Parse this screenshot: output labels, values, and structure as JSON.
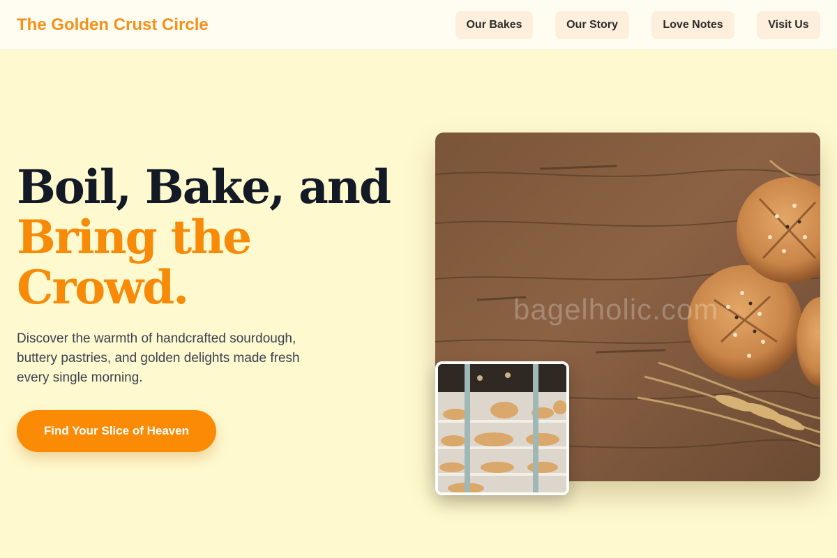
{
  "brand": {
    "name": "The Golden Crust Circle"
  },
  "nav": {
    "items": [
      {
        "label": "Our Bakes"
      },
      {
        "label": "Our Story"
      },
      {
        "label": "Love Notes"
      },
      {
        "label": "Visit Us"
      }
    ]
  },
  "hero": {
    "title_line1": "Boil, Bake, and",
    "title_line2": "Bring the",
    "title_line3": "Crowd.",
    "description": "Discover the warmth of handcrafted sourdough, buttery pastries, and golden delights made fresh every single morning.",
    "cta_label": "Find Your Slice of Heaven"
  },
  "images": {
    "main_watermark": "bagelholic.com",
    "main_alt": "Seeded bread rolls with wheat stalks on a rustic wooden table",
    "inset_alt": "Bakery display case filled with pastries and breads"
  },
  "colors": {
    "background": "#fef9cf",
    "brand": "#f59019",
    "accent": "#f78a07",
    "nav_button": "#fdefdb",
    "heading_dark": "#131a26"
  }
}
